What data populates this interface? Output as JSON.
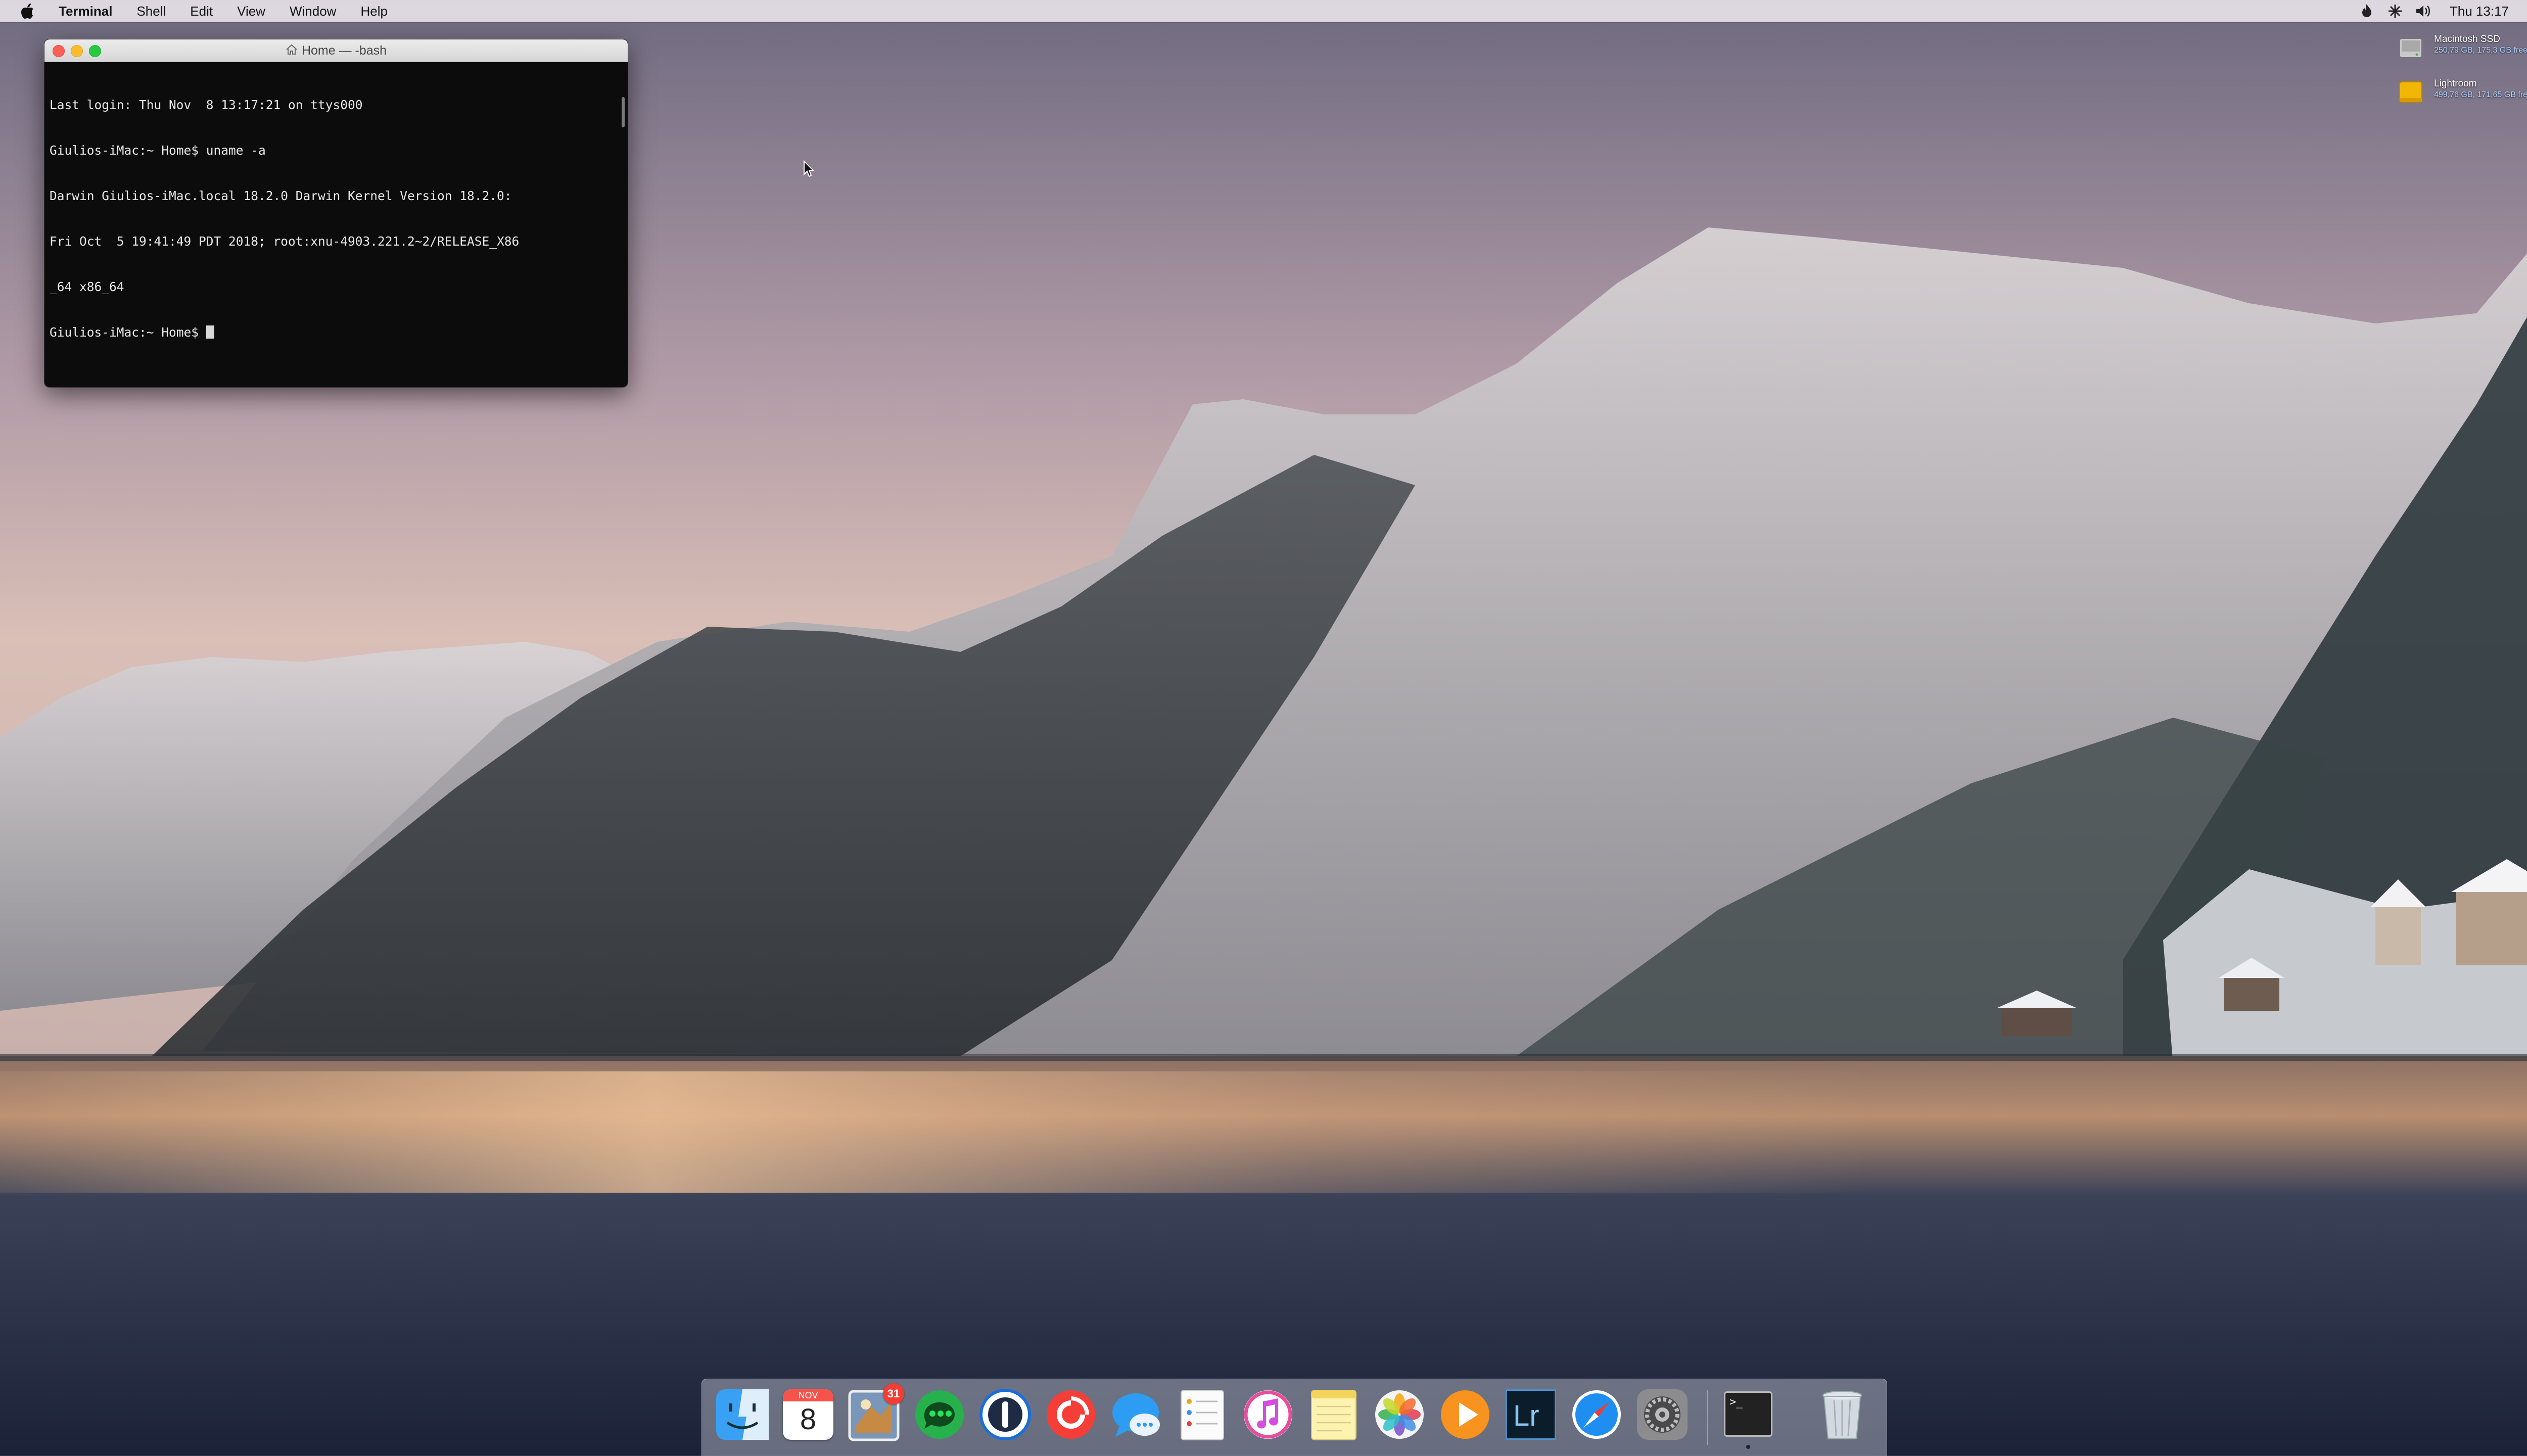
{
  "menubar": {
    "app_name": "Terminal",
    "menus": [
      "Shell",
      "Edit",
      "View",
      "Window",
      "Help"
    ],
    "clock": "Thu 13:17",
    "status_icons": [
      "flame-icon",
      "network-icon",
      "volume-icon",
      "spotlight-icon",
      "notification-center-icon"
    ]
  },
  "terminal": {
    "title": "Home — -bash",
    "lines": [
      "Last login: Thu Nov  8 13:17:21 on ttys000",
      "Giulios-iMac:~ Home$ uname -a",
      "Darwin Giulios-iMac.local 18.2.0 Darwin Kernel Version 18.2.0:",
      "Fri Oct  5 19:41:49 PDT 2018; root:xnu-4903.221.2~2/RELEASE_X86",
      "_64 x86_64",
      "Giulios-iMac:~ Home$ "
    ]
  },
  "desktop": {
    "volumes": [
      {
        "name": "Macintosh SSD",
        "info": "250,79 GB, 175,3 GB free",
        "icon": "internal-disk-icon",
        "color": "#c9c9c9"
      },
      {
        "name": "Lightroom",
        "info": "499,76 GB, 171,65 GB free",
        "icon": "external-disk-icon",
        "color": "#f2b705"
      }
    ]
  },
  "dock": {
    "items": [
      {
        "name": "finder",
        "icon": "finder-icon",
        "running": false
      },
      {
        "name": "calendar",
        "icon": "calendar-icon",
        "month": "NOV",
        "day": "8",
        "running": false
      },
      {
        "name": "mail",
        "icon": "mail-icon",
        "badge": "31",
        "running": false
      },
      {
        "name": "messages-green",
        "icon": "chat-bubble-icon",
        "running": false
      },
      {
        "name": "1password",
        "icon": "1password-icon",
        "running": false
      },
      {
        "name": "pocketcasts",
        "icon": "podcast-icon",
        "running": false
      },
      {
        "name": "messages",
        "icon": "messages-icon",
        "running": false
      },
      {
        "name": "reminders",
        "icon": "reminders-icon",
        "running": false
      },
      {
        "name": "itunes",
        "icon": "music-note-icon",
        "running": false
      },
      {
        "name": "notes",
        "icon": "notes-icon",
        "running": false
      },
      {
        "name": "photos",
        "icon": "photos-icon",
        "running": false
      },
      {
        "name": "infuse",
        "icon": "play-icon",
        "running": false
      },
      {
        "name": "lightroom",
        "icon": "lightroom-icon",
        "label": "Lr",
        "running": false
      },
      {
        "name": "safari",
        "icon": "compass-icon",
        "running": false
      },
      {
        "name": "system-preferences",
        "icon": "gear-icon",
        "running": false
      },
      {
        "name": "terminal",
        "icon": "terminal-icon",
        "label": ">_",
        "running": true
      },
      {
        "name": "trash",
        "icon": "trash-icon",
        "running": false
      }
    ]
  },
  "colors": {
    "menubar_bg": "#ece6ec",
    "terminal_bg": "#0c0c0c",
    "close": "#fc5f57",
    "minimize": "#fdbc2e",
    "maximize": "#28c840",
    "badge": "#f23c34"
  }
}
